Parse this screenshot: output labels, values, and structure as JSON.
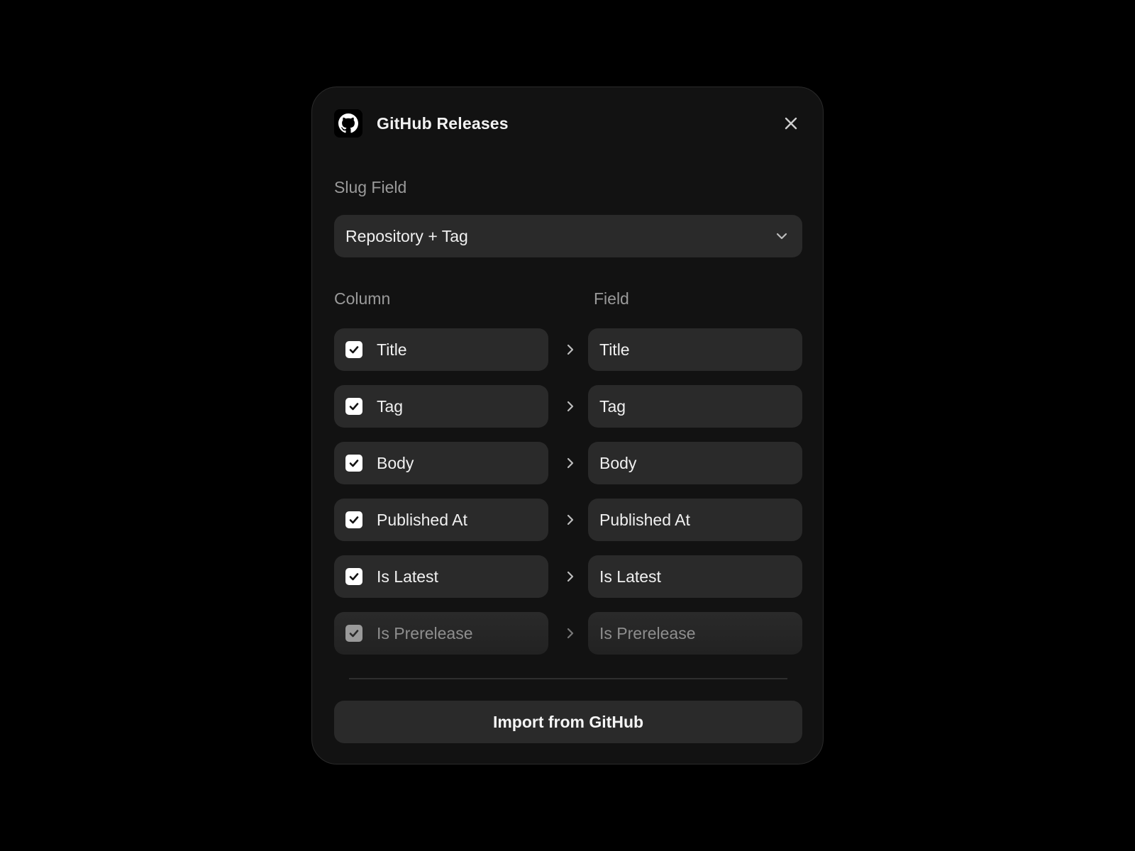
{
  "dialog": {
    "title": "GitHub Releases",
    "logo_icon": "github-icon",
    "close_icon": "close-icon"
  },
  "slug": {
    "label": "Slug Field",
    "selected": "Repository + Tag",
    "icon": "chevron-down-icon"
  },
  "mapping": {
    "column_header": "Column",
    "field_header": "Field",
    "rows": [
      {
        "column": "Title",
        "field": "Title",
        "checked": true
      },
      {
        "column": "Tag",
        "field": "Tag",
        "checked": true
      },
      {
        "column": "Body",
        "field": "Body",
        "checked": true
      },
      {
        "column": "Published At",
        "field": "Published At",
        "checked": true
      },
      {
        "column": "Is Latest",
        "field": "Is Latest",
        "checked": true
      },
      {
        "column": "Is Prerelease",
        "field": "Is Prerelease",
        "checked": true
      }
    ]
  },
  "actions": {
    "import_label": "Import from GitHub"
  },
  "colors": {
    "background": "#000000",
    "panel": "#121212",
    "control": "#2a2a2a",
    "text": "#f0f0f0",
    "muted": "#9a9a9a"
  }
}
